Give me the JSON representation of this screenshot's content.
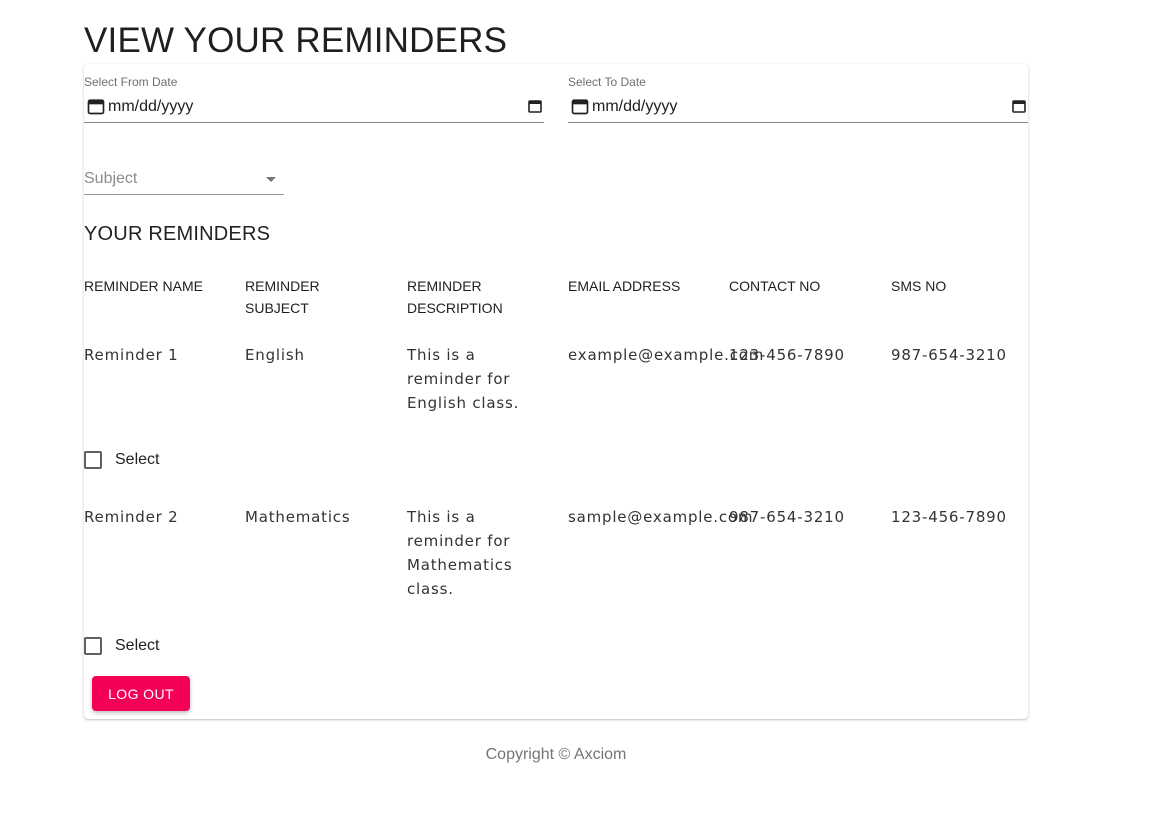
{
  "page": {
    "title": "VIEW YOUR REMINDERS"
  },
  "filters": {
    "from_date": {
      "label": "Select From Date",
      "placeholder": "mm/dd/yyyy"
    },
    "to_date": {
      "label": "Select To Date",
      "placeholder": "mm/dd/yyyy"
    },
    "subject": {
      "placeholder": "Subject"
    }
  },
  "reminders_section": {
    "title": "YOUR REMINDERS",
    "columns": [
      "REMINDER NAME",
      "REMINDER SUBJECT",
      "REMINDER DESCRIPTION",
      "EMAIL ADDRESS",
      "CONTACT NO",
      "SMS NO"
    ],
    "rows": [
      {
        "name": "Reminder 1",
        "subject": "English",
        "description": "This is a reminder for English class.",
        "email": "example@example.com",
        "contact": "123-456-7890",
        "sms": "987-654-3210",
        "select_label": "Select"
      },
      {
        "name": "Reminder 2",
        "subject": "Mathematics",
        "description": "This is a reminder for Mathematics class.",
        "email": "sample@example.com",
        "contact": "987-654-3210",
        "sms": "123-456-7890",
        "select_label": "Select"
      }
    ]
  },
  "actions": {
    "logout_label": "LOG OUT"
  },
  "footer": {
    "text": "Copyright © Axciom"
  },
  "colors": {
    "accent": "#f50057",
    "text": "#212121",
    "muted": "#757575"
  },
  "icons": {
    "date_left": "calendar-icon",
    "date_right": "calendar-icon",
    "subject": "dropdown-arrow-icon"
  }
}
